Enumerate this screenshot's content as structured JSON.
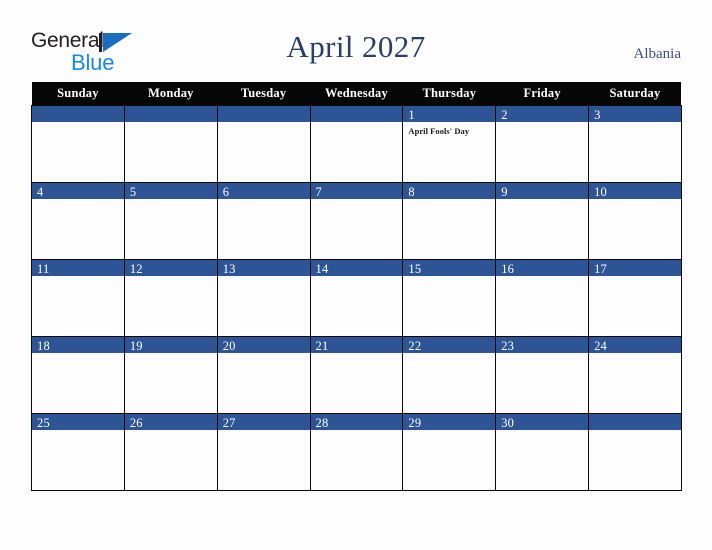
{
  "logo": {
    "word_one": "General",
    "word_two": "Blue",
    "triangle_icon": "triangle-icon",
    "colors": {
      "word_one": "#231f20",
      "word_two": "#1b8ade",
      "triangle": "#1b6dc1"
    }
  },
  "header": {
    "title": "April 2027",
    "country": "Albania",
    "title_color": "#2b3f66",
    "country_color": "#3c5080"
  },
  "calendar": {
    "accent_color": "#2d5494",
    "header_bg": "#070707",
    "day_headers": [
      "Sunday",
      "Monday",
      "Tuesday",
      "Wednesday",
      "Thursday",
      "Friday",
      "Saturday"
    ],
    "weeks": [
      [
        {
          "day": "",
          "events": []
        },
        {
          "day": "",
          "events": []
        },
        {
          "day": "",
          "events": []
        },
        {
          "day": "",
          "events": []
        },
        {
          "day": "1",
          "events": [
            "April Fools' Day"
          ]
        },
        {
          "day": "2",
          "events": []
        },
        {
          "day": "3",
          "events": []
        }
      ],
      [
        {
          "day": "4",
          "events": []
        },
        {
          "day": "5",
          "events": []
        },
        {
          "day": "6",
          "events": []
        },
        {
          "day": "7",
          "events": []
        },
        {
          "day": "8",
          "events": []
        },
        {
          "day": "9",
          "events": []
        },
        {
          "day": "10",
          "events": []
        }
      ],
      [
        {
          "day": "11",
          "events": []
        },
        {
          "day": "12",
          "events": []
        },
        {
          "day": "13",
          "events": []
        },
        {
          "day": "14",
          "events": []
        },
        {
          "day": "15",
          "events": []
        },
        {
          "day": "16",
          "events": []
        },
        {
          "day": "17",
          "events": []
        }
      ],
      [
        {
          "day": "18",
          "events": []
        },
        {
          "day": "19",
          "events": []
        },
        {
          "day": "20",
          "events": []
        },
        {
          "day": "21",
          "events": []
        },
        {
          "day": "22",
          "events": []
        },
        {
          "day": "23",
          "events": []
        },
        {
          "day": "24",
          "events": []
        }
      ],
      [
        {
          "day": "25",
          "events": []
        },
        {
          "day": "26",
          "events": []
        },
        {
          "day": "27",
          "events": []
        },
        {
          "day": "28",
          "events": []
        },
        {
          "day": "29",
          "events": []
        },
        {
          "day": "30",
          "events": []
        },
        {
          "day": "",
          "events": []
        }
      ]
    ]
  }
}
